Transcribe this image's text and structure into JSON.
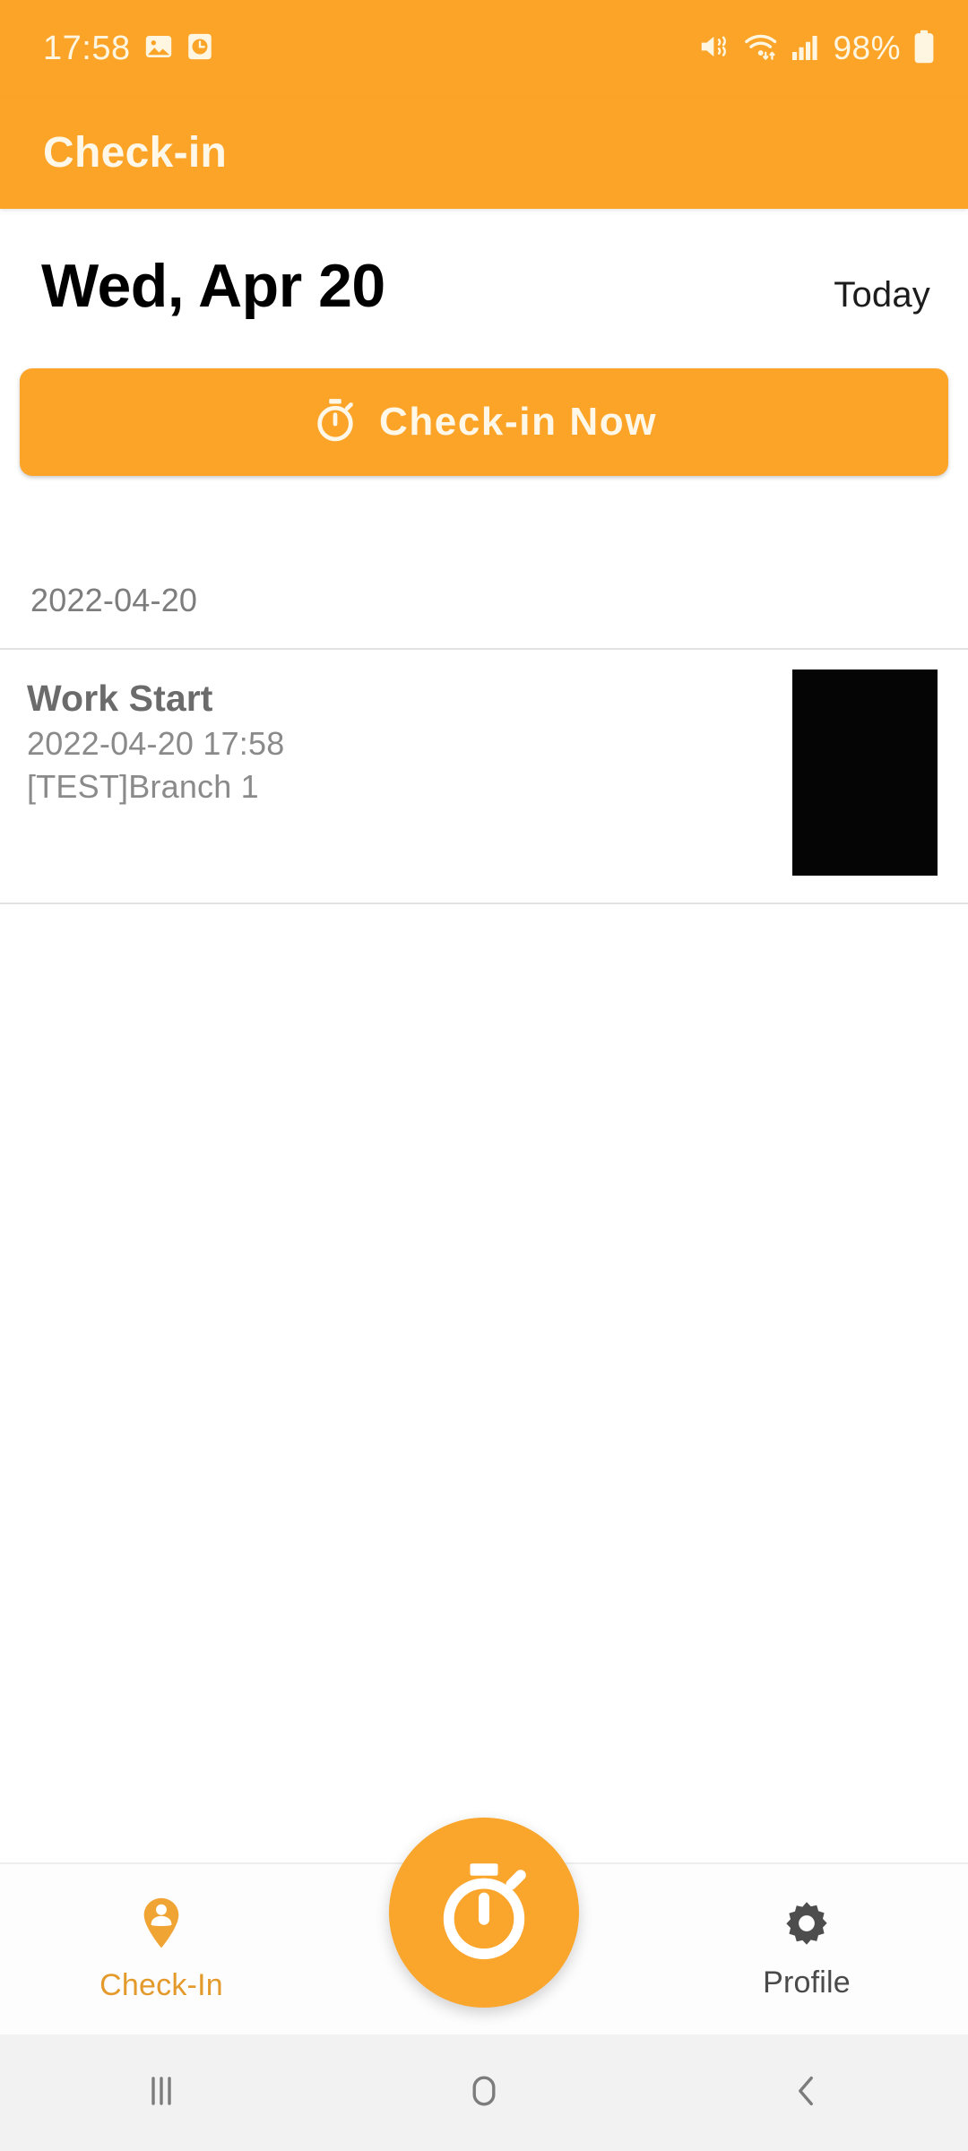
{
  "status_bar": {
    "time": "17:58",
    "battery_percent": "98%",
    "left_icons": [
      "gallery-icon",
      "alarm-clock-icon"
    ],
    "right_icons": [
      "mute-vibrate-icon",
      "wifi-icon",
      "cellular-signal-icon",
      "battery-icon"
    ],
    "background_color": "#FBA428",
    "text_color": "#FFF6E2"
  },
  "app_bar": {
    "title": "Check-in",
    "background_color": "#FBA428",
    "title_color": "#FFF7E8"
  },
  "header": {
    "date_label": "Wed, Apr 20",
    "today_label": "Today"
  },
  "primary_action": {
    "label": "Check-in Now",
    "icon": "stopwatch-icon",
    "background_color": "#FBA428",
    "text_color": "#FFF7E8"
  },
  "list": {
    "section_date": "2022-04-20",
    "entries": [
      {
        "title": "Work Start",
        "timestamp": "2022-04-20 17:58",
        "branch": "[TEST]Branch 1",
        "thumbnail": "photo-thumbnail",
        "thumbnail_color": "#050505"
      }
    ]
  },
  "bottom_nav": {
    "items": [
      {
        "label": "Check-In",
        "icon": "map-pin-person-icon",
        "active": true,
        "color": "#E49A2B"
      },
      {
        "label": "Profile",
        "icon": "gear-icon",
        "active": false,
        "color": "#4a4a4a"
      }
    ],
    "fab": {
      "icon": "stopwatch-icon",
      "background_color": "#FAA52B"
    }
  },
  "system_nav": {
    "buttons": [
      "recents-icon",
      "home-icon",
      "back-icon"
    ],
    "background_color": "#F2F2F2"
  }
}
